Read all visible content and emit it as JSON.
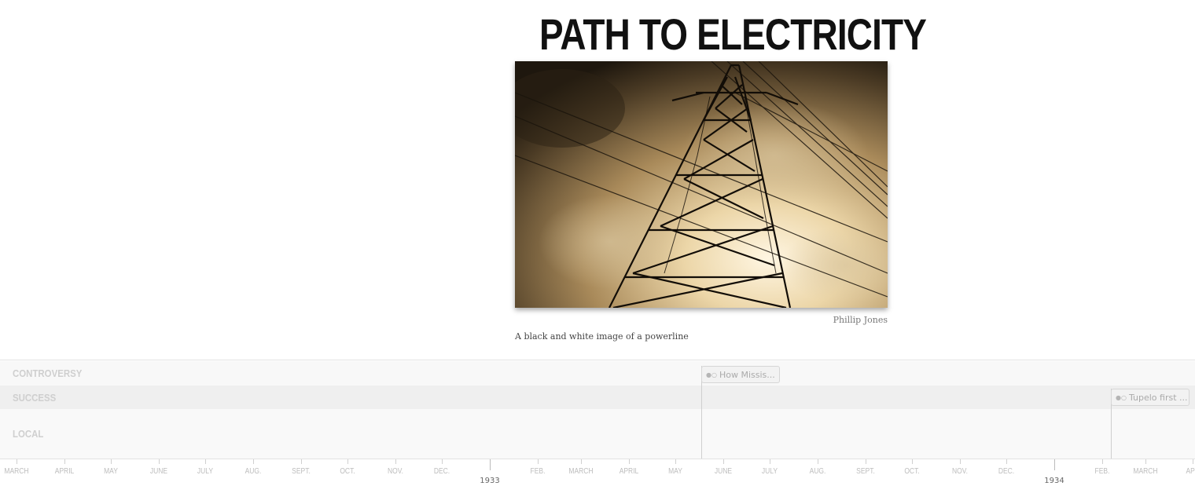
{
  "slide": {
    "title": "PATH TO ELECTRICITY",
    "image_alt": "A black and white image of a powerline",
    "credit": "Phillip Jones",
    "caption": "A black and white image of a powerline"
  },
  "timeline": {
    "groups": [
      {
        "label": "CONTROVERSY"
      },
      {
        "label": "SUCCESS"
      },
      {
        "label": "LOCAL"
      }
    ],
    "events": [
      {
        "label": "How Missis...",
        "group": "CONTROVERSY",
        "icon": "double-dot-icon"
      },
      {
        "label": "Tupelo first ...",
        "group": "SUCCESS",
        "icon": "double-dot-icon"
      }
    ],
    "months": [
      "MARCH",
      "APRIL",
      "MAY",
      "JUNE",
      "JULY",
      "AUG.",
      "SEPT.",
      "OCT.",
      "NOV.",
      "DEC.",
      "FEB.",
      "MARCH",
      "APRIL",
      "MAY",
      "JUNE",
      "JULY",
      "AUG.",
      "SEPT.",
      "OCT.",
      "NOV.",
      "DEC.",
      "FEB.",
      "MARCH",
      "APRIL"
    ],
    "years": [
      "1933",
      "1934"
    ]
  }
}
